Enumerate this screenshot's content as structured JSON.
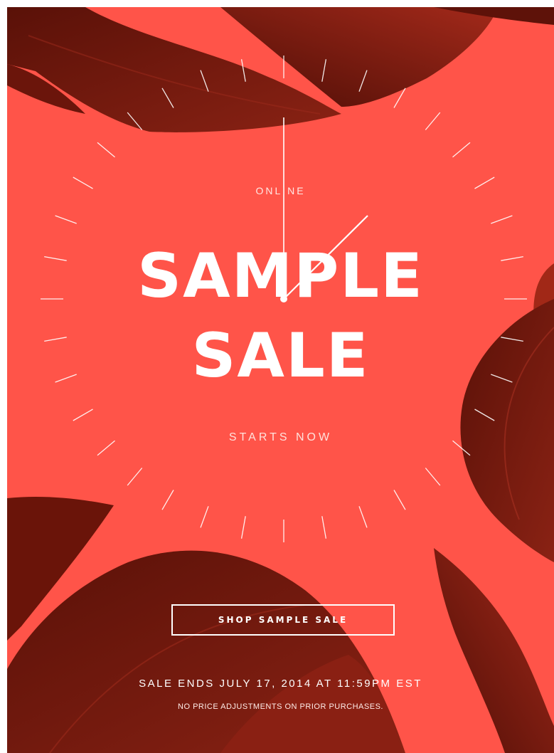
{
  "colors": {
    "background": "#ff5449",
    "leaf": "#7a1a0f",
    "leaf_dark": "#4a0d06",
    "text": "#ffffff"
  },
  "hero": {
    "eyebrow": "ONLINE",
    "headline_line1": "SAMPLE",
    "headline_line2": "SALE",
    "subhead": "STARTS NOW"
  },
  "clock": {
    "icon": "clock-dial",
    "tick_count": 36
  },
  "cta": {
    "label": "SHOP SAMPLE SALE"
  },
  "footer": {
    "sale_ends": "SALE ENDS JULY 17, 2014 AT 11:59PM EST",
    "disclaimer": "NO PRICE ADJUSTMENTS ON PRIOR PURCHASES."
  }
}
